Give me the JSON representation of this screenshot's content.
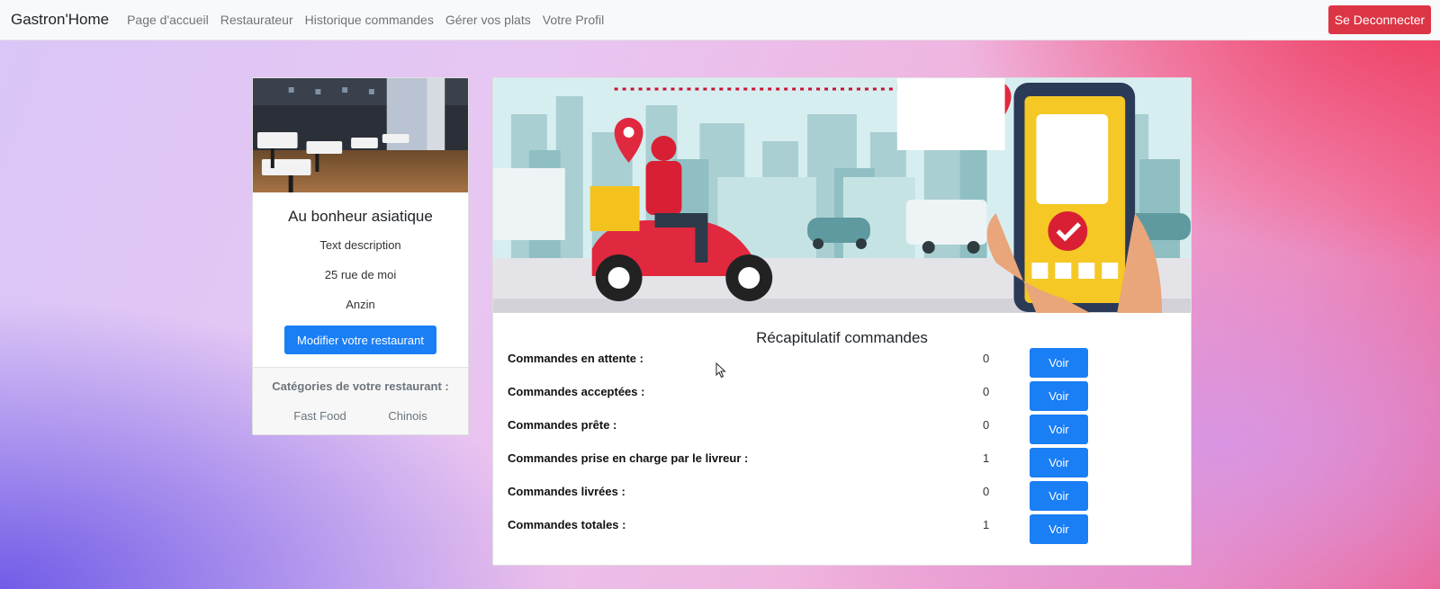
{
  "navbar": {
    "brand": "Gastron'Home",
    "links": [
      "Page d'accueil",
      "Restaurateur",
      "Historique commandes",
      "Gérer vos plats",
      "Votre Profil"
    ],
    "logout_label": "Se Deconnecter"
  },
  "restaurant": {
    "name": "Au bonheur asiatique",
    "description": "Text description",
    "address": "25 rue de moi",
    "city": "Anzin",
    "modify_label": "Modifier votre restaurant",
    "categories_title": "Catégories de votre restaurant :",
    "categories": [
      "Fast Food",
      "Chinois"
    ]
  },
  "recap": {
    "title": "Récapitulatif commandes",
    "button_label": "Voir",
    "rows": [
      {
        "label": "Commandes en attente :",
        "count": "0"
      },
      {
        "label": "Commandes acceptées :",
        "count": "0"
      },
      {
        "label": "Commandes prête :",
        "count": "0"
      },
      {
        "label": "Commandes prise en charge par le livreur :",
        "count": "1"
      },
      {
        "label": "Commandes livrées :",
        "count": "0"
      },
      {
        "label": "Commandes totales :",
        "count": "1"
      }
    ]
  },
  "colors": {
    "primary": "#1a7ef5",
    "danger": "#dc3545",
    "navbar_bg": "#f8f9fa"
  }
}
